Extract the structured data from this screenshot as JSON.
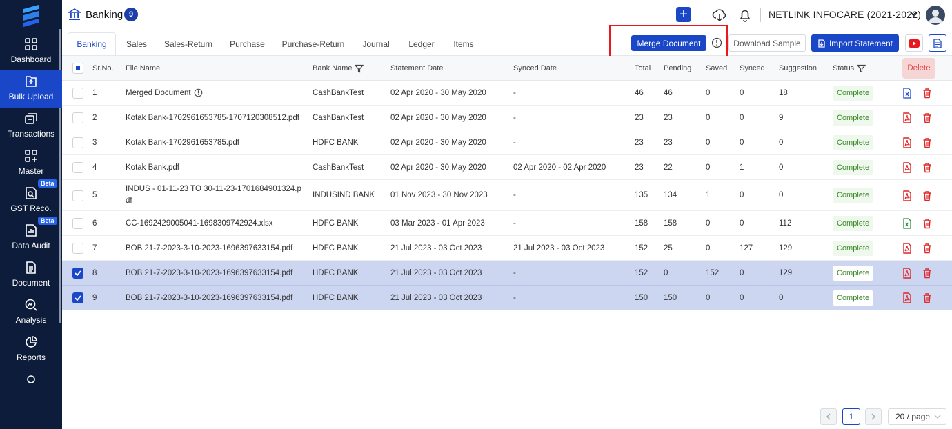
{
  "sidebar": {
    "items": [
      {
        "label": "Dashboard",
        "icon": "dashboard-icon"
      },
      {
        "label": "Bulk Upload",
        "icon": "upload-icon",
        "active": true
      },
      {
        "label": "Transactions",
        "icon": "transactions-icon"
      },
      {
        "label": "Master",
        "icon": "master-icon"
      },
      {
        "label": "GST Reco.",
        "icon": "gst-icon",
        "badge": "Beta"
      },
      {
        "label": "Data Audit",
        "icon": "audit-icon",
        "badge": "Beta"
      },
      {
        "label": "Document",
        "icon": "document-icon"
      },
      {
        "label": "Analysis",
        "icon": "analysis-icon"
      },
      {
        "label": "Reports",
        "icon": "reports-icon"
      }
    ]
  },
  "header": {
    "title": "Banking",
    "count": "9",
    "company": "NETLINK INFOCARE (2021-2022)"
  },
  "tabs": [
    "Banking",
    "Sales",
    "Sales-Return",
    "Purchase",
    "Purchase-Return",
    "Journal",
    "Ledger",
    "Items"
  ],
  "toolbar": {
    "merge": "Merge Document",
    "download": "Download Sample",
    "import": "Import Statement"
  },
  "columns": {
    "sr": "Sr.No.",
    "file": "File Name",
    "bank": "Bank Name",
    "statement": "Statement Date",
    "synced_date": "Synced Date",
    "total": "Total",
    "pending": "Pending",
    "saved": "Saved",
    "synced": "Synced",
    "suggestion": "Suggestion",
    "status": "Status",
    "delete": "Delete"
  },
  "rows": [
    {
      "sr": "1",
      "file": "Merged Document",
      "bank": "CashBankTest",
      "statement": "02 Apr 2020 - 30 May 2020",
      "synced_date": "-",
      "total": "46",
      "pending": "46",
      "saved": "0",
      "synced": "0",
      "suggestion": "18",
      "status": "Complete",
      "type": "merged",
      "selected": false
    },
    {
      "sr": "2",
      "file": "Kotak Bank-1702961653785-1707120308512.pdf",
      "bank": "CashBankTest",
      "statement": "02 Apr 2020 - 30 May 2020",
      "synced_date": "-",
      "total": "23",
      "pending": "23",
      "saved": "0",
      "synced": "0",
      "suggestion": "9",
      "status": "Complete",
      "type": "pdf",
      "selected": false
    },
    {
      "sr": "3",
      "file": "Kotak Bank-1702961653785.pdf",
      "bank": "HDFC BANK",
      "statement": "02 Apr 2020 - 30 May 2020",
      "synced_date": "-",
      "total": "23",
      "pending": "23",
      "saved": "0",
      "synced": "0",
      "suggestion": "0",
      "status": "Complete",
      "type": "pdf",
      "selected": false
    },
    {
      "sr": "4",
      "file": "Kotak Bank.pdf",
      "bank": "CashBankTest",
      "statement": "02 Apr 2020 - 30 May 2020",
      "synced_date": "02 Apr 2020 - 02 Apr 2020",
      "total": "23",
      "pending": "22",
      "saved": "0",
      "synced": "1",
      "suggestion": "0",
      "status": "Complete",
      "type": "pdf",
      "selected": false
    },
    {
      "sr": "5",
      "file": "INDUS - 01-11-23 TO 30-11-23-1701684901324.p",
      "file2": "df",
      "bank": "INDUSIND BANK",
      "statement": "01 Nov 2023 - 30 Nov 2023",
      "synced_date": "-",
      "total": "135",
      "pending": "134",
      "saved": "1",
      "synced": "0",
      "suggestion": "0",
      "status": "Complete",
      "type": "pdf",
      "selected": false
    },
    {
      "sr": "6",
      "file": "CC-1692429005041-1698309742924.xlsx",
      "bank": "HDFC BANK",
      "statement": "03 Mar 2023 - 01 Apr 2023",
      "synced_date": "-",
      "total": "158",
      "pending": "158",
      "saved": "0",
      "synced": "0",
      "suggestion": "112",
      "status": "Complete",
      "type": "excel",
      "selected": false
    },
    {
      "sr": "7",
      "file": "BOB 21-7-2023-3-10-2023-1696397633154.pdf",
      "bank": "HDFC BANK",
      "statement": "21 Jul 2023 - 03 Oct 2023",
      "synced_date": "21 Jul 2023 - 03 Oct 2023",
      "total": "152",
      "pending": "25",
      "saved": "0",
      "synced": "127",
      "suggestion": "129",
      "status": "Complete",
      "type": "pdf",
      "selected": false
    },
    {
      "sr": "8",
      "file": "BOB 21-7-2023-3-10-2023-1696397633154.pdf",
      "bank": "HDFC BANK",
      "statement": "21 Jul 2023 - 03 Oct 2023",
      "synced_date": "-",
      "total": "152",
      "pending": "0",
      "saved": "152",
      "synced": "0",
      "suggestion": "129",
      "status": "Complete",
      "type": "pdf",
      "selected": true
    },
    {
      "sr": "9",
      "file": "BOB 21-7-2023-3-10-2023-1696397633154.pdf",
      "bank": "HDFC BANK",
      "statement": "21 Jul 2023 - 03 Oct 2023",
      "synced_date": "-",
      "total": "150",
      "pending": "150",
      "saved": "0",
      "synced": "0",
      "suggestion": "0",
      "status": "Complete",
      "type": "pdf",
      "selected": true
    }
  ],
  "pagination": {
    "current": "1",
    "page_size": "20 / page"
  }
}
